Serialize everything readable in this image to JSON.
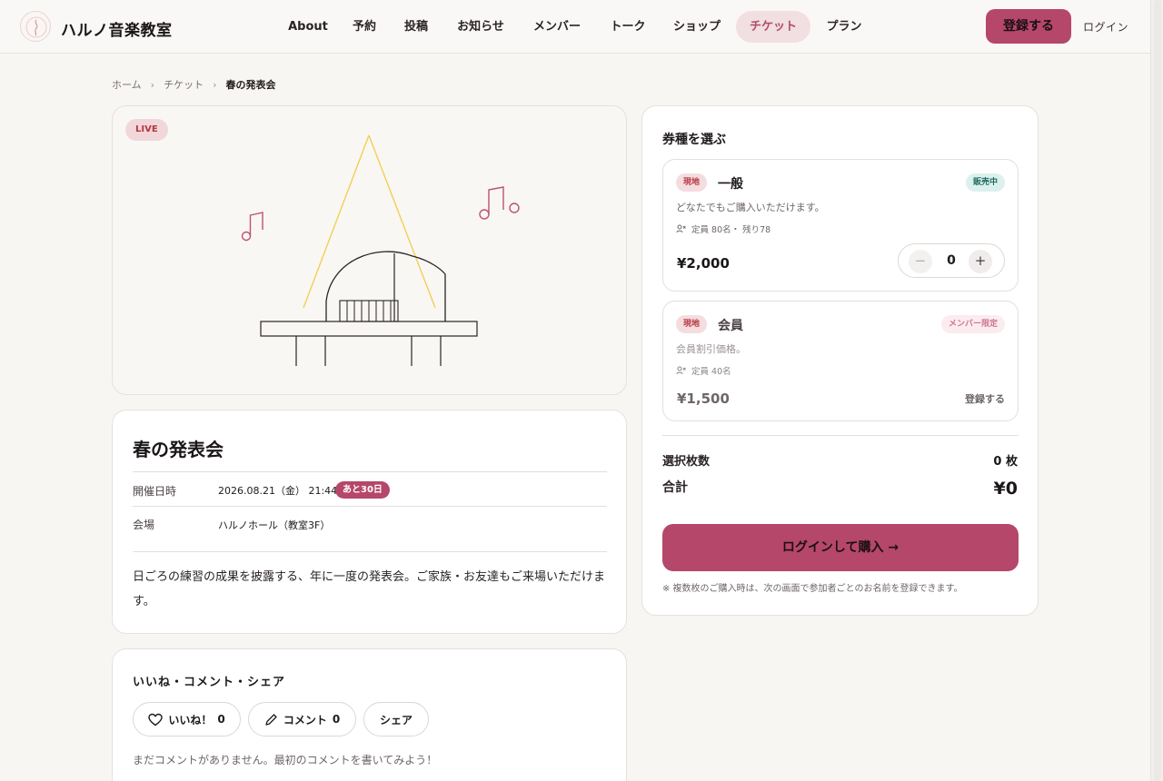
{
  "header": {
    "brand": "ハルノ音楽教室",
    "nav": [
      {
        "label": "About",
        "active": false
      },
      {
        "label": "予約",
        "active": false
      },
      {
        "label": "投稿",
        "active": false
      },
      {
        "label": "お知らせ",
        "active": false
      },
      {
        "label": "メンバー",
        "active": false
      },
      {
        "label": "トーク",
        "active": false
      },
      {
        "label": "ショップ",
        "active": false
      },
      {
        "label": "チケット",
        "active": true
      },
      {
        "label": "プラン",
        "active": false
      }
    ],
    "register_label": "登録する",
    "login_label": "ログイン"
  },
  "breadcrumb": {
    "items": [
      "ホーム",
      "チケット",
      "春の発表会"
    ],
    "separator": "›"
  },
  "hero": {
    "badge": "LIVE",
    "illustration": "grand-piano-on-stage-with-spotlight-and-music-notes"
  },
  "event": {
    "title": "春の発表会",
    "date_label": "開催日時",
    "date_value": "2026.08.21（金） 21:44",
    "countdown": "あと30日",
    "venue_label": "会場",
    "venue_value": "ハルノホール（教室3F）",
    "description": "日ごろの練習の成果を披露する、年に一度の発表会。ご家族・お友達もご来場いただけます。"
  },
  "social": {
    "title": "いいね・コメント・シェア",
    "like_label": "いいね！",
    "like_count": "0",
    "comment_label": "コメント",
    "comment_count": "0",
    "share_label": "シェア",
    "empty_text": "まだコメントがありません。最初のコメントを書いてみよう！"
  },
  "tickets": {
    "title": "券種を選ぶ",
    "items": [
      {
        "place_tag": "現地",
        "name": "一般",
        "status": "販売中",
        "description": "どなたでもご購入いただけます。",
        "capacity": "定員 80名・ 残り78",
        "price": "¥2,000",
        "quantity": "0"
      },
      {
        "place_tag": "現地",
        "name": "会員",
        "status": "メンバー限定",
        "description": "会員割引価格。",
        "capacity": "定員 40名",
        "price": "¥1,500",
        "action": "登録する"
      }
    ],
    "count_label": "選択枚数",
    "count_value": "0 枚",
    "total_label": "合計",
    "total_value": "¥0",
    "buy_label": "ログインして購入 →",
    "note": "※ 複数枚のご購入時は、次の画面で参加者ごとのお名前を登録できます。"
  },
  "colors": {
    "accent": "#b5476b",
    "live_badge_bg": "#f1d7da",
    "sale_badge_bg": "#dcf1ee",
    "spotlight": "#f2cf55",
    "note_color": "#c05070",
    "background": "#f8f6f3"
  }
}
